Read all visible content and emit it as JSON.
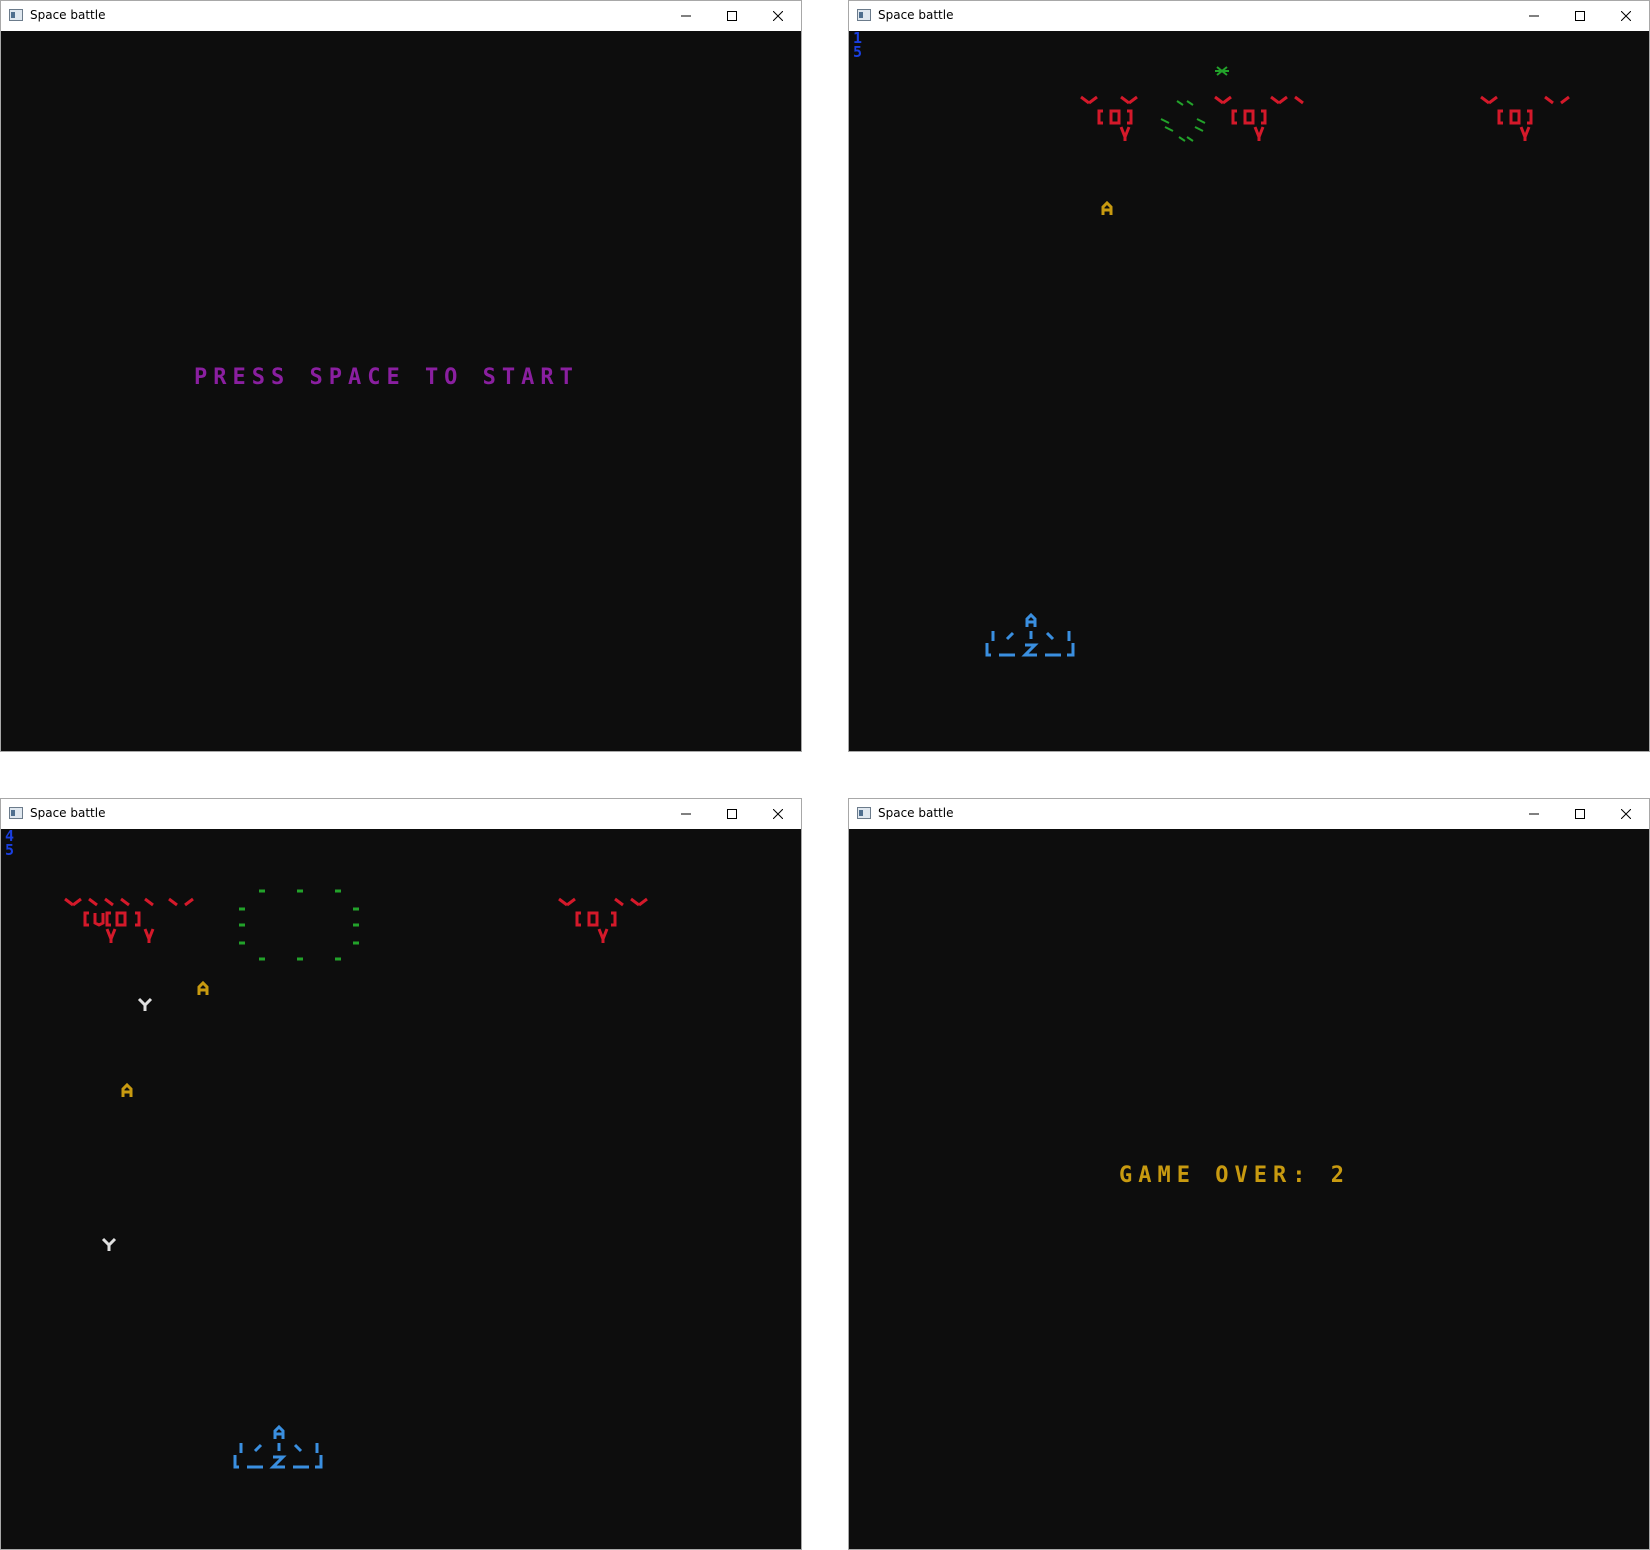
{
  "windows": [
    {
      "title": "Space battle",
      "message": "PRESS SPACE TO START"
    },
    {
      "title": "Space battle",
      "hud": {
        "line1": "1",
        "line2": "5"
      }
    },
    {
      "title": "Space battle",
      "hud": {
        "line1": "4",
        "line2": "5"
      }
    },
    {
      "title": "Space battle",
      "message": "GAME OVER: 2"
    }
  ],
  "window_controls": [
    "minimize-icon",
    "maximize-icon",
    "close-icon"
  ],
  "colors": {
    "background": "#0d0d0d",
    "start_message": "#8a1fa0",
    "game_over_message": "#c89a10",
    "hud": "#1a3fe0",
    "enemy": "#d4192a",
    "player": "#3a8fe0",
    "explosion": "#22a22a",
    "player_missile": "#c89a10",
    "enemy_bomb": "#e0e0e0"
  }
}
